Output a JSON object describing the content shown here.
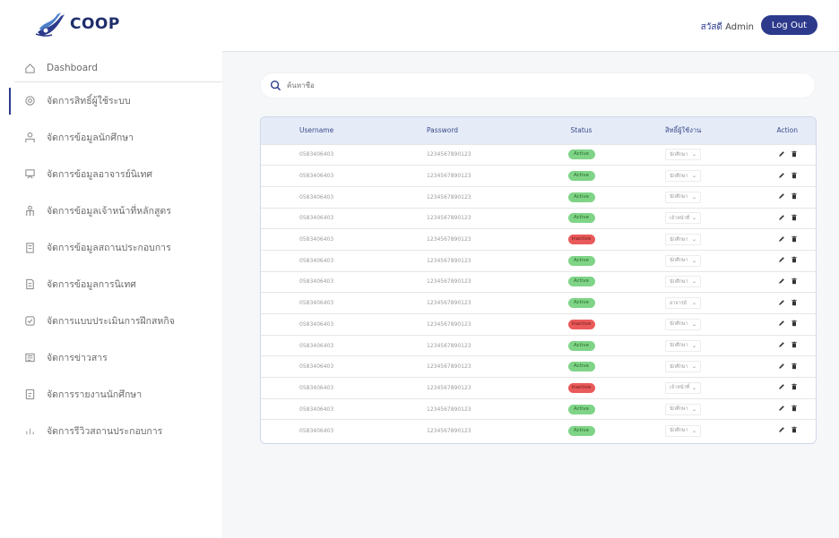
{
  "brand": {
    "name": "COOP"
  },
  "header": {
    "greeting": "สวัสดี",
    "user": "Admin",
    "logout_label": "Log Out"
  },
  "search": {
    "placeholder": "ค้นหาชื่อ"
  },
  "sidebar": {
    "items": [
      {
        "label": "Dashboard",
        "icon": "home-icon"
      },
      {
        "label": "จัดการสิทธิ์ผู้ใช้ระบบ",
        "icon": "settings-icon"
      },
      {
        "label": "จัดการข้อมูลนักศึกษา",
        "icon": "student-icon"
      },
      {
        "label": "จัดการข้อมูลอาจารย์นิเทศ",
        "icon": "teacher-icon"
      },
      {
        "label": "จัดการข้อมูลเจ้าหน้าที่หลักสูตร",
        "icon": "staff-icon"
      },
      {
        "label": "จัดการข้อมูลสถานประกอบการ",
        "icon": "building-icon"
      },
      {
        "label": "จัดการข้อมูลการนิเทศ",
        "icon": "document-icon"
      },
      {
        "label": "จัดการแบบประเมินการฝึกสหกิจ",
        "icon": "evaluation-icon"
      },
      {
        "label": "จัดการข่าวสาร",
        "icon": "news-icon"
      },
      {
        "label": "จัดการรายงานนักศึกษา",
        "icon": "report-icon"
      },
      {
        "label": "จัดการรีวิวสถานประกอบการ",
        "icon": "review-icon"
      }
    ]
  },
  "table": {
    "headers": {
      "username": "Username",
      "password": "Password",
      "status": "Status",
      "role": "สิทธิ์ผู้ใช้งาน",
      "action": "Action"
    },
    "rows": [
      {
        "username": "0583406403",
        "password": "1234567890123",
        "status": "Active",
        "role": "นักศึกษา"
      },
      {
        "username": "0583406403",
        "password": "1234567890123",
        "status": "Active",
        "role": "นักศึกษา"
      },
      {
        "username": "0583406403",
        "password": "1234567890123",
        "status": "Active",
        "role": "นักศึกษา"
      },
      {
        "username": "0583406403",
        "password": "1234567890123",
        "status": "Active",
        "role": "เจ้าหน้าที่"
      },
      {
        "username": "0583406403",
        "password": "1234567890123",
        "status": "Inactive",
        "role": "นักศึกษา"
      },
      {
        "username": "0583406403",
        "password": "1234567890123",
        "status": "Active",
        "role": "นักศึกษา"
      },
      {
        "username": "0583406403",
        "password": "1234567890123",
        "status": "Active",
        "role": "นักศึกษา"
      },
      {
        "username": "0583406403",
        "password": "1234567890123",
        "status": "Active",
        "role": "อาจารย์"
      },
      {
        "username": "0583406403",
        "password": "1234567890123",
        "status": "Inactive",
        "role": "นักศึกษา"
      },
      {
        "username": "0583406403",
        "password": "1234567890123",
        "status": "Active",
        "role": "นักศึกษา"
      },
      {
        "username": "0583406403",
        "password": "1234567890123",
        "status": "Active",
        "role": "นักศึกษา"
      },
      {
        "username": "0583406403",
        "password": "1234567890123",
        "status": "Inactive",
        "role": "เจ้าหน้าที่"
      },
      {
        "username": "0583406403",
        "password": "1234567890123",
        "status": "Active",
        "role": "นักศึกษา"
      },
      {
        "username": "0583406403",
        "password": "1234567890123",
        "status": "Active",
        "role": "นักศึกษา"
      }
    ]
  },
  "colors": {
    "primary": "#2d3a8c",
    "active": "#7fd487",
    "inactive": "#ea5a5a",
    "header_row": "#e5ecf8"
  }
}
